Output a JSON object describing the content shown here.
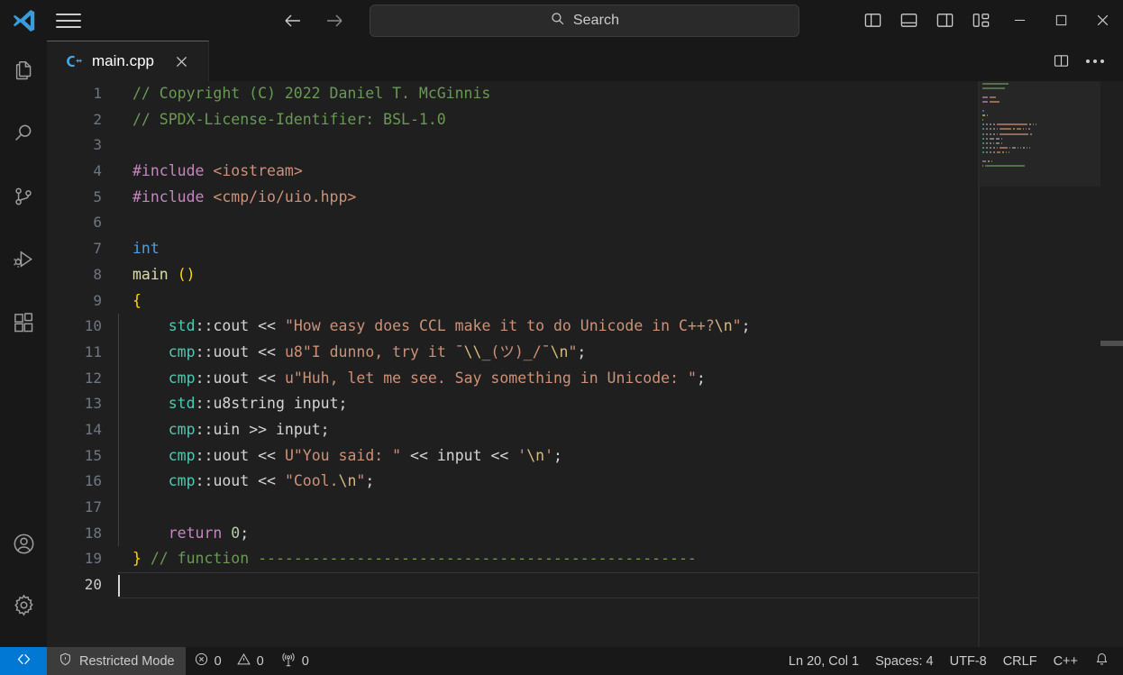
{
  "titlebar": {
    "logo_icon": "vscode-logo-icon",
    "menu_icon": "hamburger-menu-icon",
    "back_icon": "arrow-left-icon",
    "forward_icon": "arrow-right-icon",
    "search": {
      "icon": "search-icon",
      "label": "Search",
      "placeholder": "Search"
    },
    "layout_buttons": [
      {
        "name": "toggle-primary-sidebar-button",
        "icon": "layout-sidebar-left-icon"
      },
      {
        "name": "toggle-panel-button",
        "icon": "layout-panel-bottom-icon"
      },
      {
        "name": "toggle-secondary-sidebar-button",
        "icon": "layout-sidebar-right-icon"
      },
      {
        "name": "customize-layout-button",
        "icon": "layout-customize-icon"
      }
    ],
    "window_controls": [
      {
        "name": "minimize-button",
        "icon": "minimize-icon"
      },
      {
        "name": "maximize-button",
        "icon": "maximize-icon"
      },
      {
        "name": "close-button",
        "icon": "close-icon"
      }
    ]
  },
  "activitybar": {
    "top_items": [
      {
        "name": "sidebar-item-explorer",
        "icon": "files-icon",
        "label": "Explorer"
      },
      {
        "name": "sidebar-item-search",
        "icon": "search-icon",
        "label": "Search"
      },
      {
        "name": "sidebar-item-source-control",
        "icon": "source-control-branch-icon",
        "label": "Source Control"
      },
      {
        "name": "sidebar-item-run-debug",
        "icon": "run-and-debug-icon",
        "label": "Run and Debug"
      },
      {
        "name": "sidebar-item-extensions",
        "icon": "extensions-blocks-icon",
        "label": "Extensions"
      }
    ],
    "bottom_items": [
      {
        "name": "sidebar-item-account",
        "icon": "account-person-icon",
        "label": "Accounts"
      },
      {
        "name": "sidebar-item-settings",
        "icon": "gear-icon",
        "label": "Manage"
      }
    ]
  },
  "tabbar": {
    "tabs": [
      {
        "name": "tab-main-cpp",
        "label": "main.cpp",
        "icon": "cpp-file-icon",
        "active": true,
        "close_icon": "close-icon"
      }
    ],
    "actions": [
      {
        "name": "split-editor-right-button",
        "icon": "split-editor-icon"
      },
      {
        "name": "more-actions-button",
        "icon": "ellipsis-icon"
      }
    ]
  },
  "editor": {
    "language": "cpp",
    "first_line": 1,
    "lines": [
      {
        "n": 1,
        "tokens": [
          {
            "t": "// Copyright (C) 2022 Daniel T. McGinnis",
            "c": "t-com"
          }
        ]
      },
      {
        "n": 2,
        "tokens": [
          {
            "t": "// SPDX-License-Identifier: BSL-1.0",
            "c": "t-com"
          }
        ]
      },
      {
        "n": 3,
        "tokens": []
      },
      {
        "n": 4,
        "tokens": [
          {
            "t": "#include",
            "c": "t-pre"
          },
          {
            "t": " ",
            "c": "t-plain"
          },
          {
            "t": "<iostream>",
            "c": "t-hdr"
          }
        ]
      },
      {
        "n": 5,
        "tokens": [
          {
            "t": "#include",
            "c": "t-pre"
          },
          {
            "t": " ",
            "c": "t-plain"
          },
          {
            "t": "<cmp/io/uio.hpp>",
            "c": "t-hdr"
          }
        ]
      },
      {
        "n": 6,
        "tokens": []
      },
      {
        "n": 7,
        "tokens": [
          {
            "t": "int",
            "c": "t-type"
          }
        ]
      },
      {
        "n": 8,
        "tokens": [
          {
            "t": "main",
            "c": "t-fn"
          },
          {
            "t": " ",
            "c": "t-plain"
          },
          {
            "t": "()",
            "c": "t-brk"
          }
        ]
      },
      {
        "n": 9,
        "tokens": [
          {
            "t": "{",
            "c": "t-brk"
          }
        ]
      },
      {
        "n": 10,
        "tokens": [
          {
            "t": "    ",
            "c": "t-plain"
          },
          {
            "t": "std",
            "c": "t-ns"
          },
          {
            "t": "::",
            "c": "t-plain"
          },
          {
            "t": "cout",
            "c": "t-plain"
          },
          {
            "t": " ",
            "c": "t-plain"
          },
          {
            "t": "<<",
            "c": "t-op"
          },
          {
            "t": " ",
            "c": "t-plain"
          },
          {
            "t": "\"How easy does CCL make it to do Unicode in C++?",
            "c": "t-str"
          },
          {
            "t": "\\n",
            "c": "t-esc"
          },
          {
            "t": "\"",
            "c": "t-str"
          },
          {
            "t": ";",
            "c": "t-plain"
          }
        ]
      },
      {
        "n": 11,
        "tokens": [
          {
            "t": "    ",
            "c": "t-plain"
          },
          {
            "t": "cmp",
            "c": "t-ns"
          },
          {
            "t": "::",
            "c": "t-plain"
          },
          {
            "t": "uout",
            "c": "t-plain"
          },
          {
            "t": " ",
            "c": "t-plain"
          },
          {
            "t": "<<",
            "c": "t-op"
          },
          {
            "t": " ",
            "c": "t-plain"
          },
          {
            "t": "u8",
            "c": "t-str"
          },
          {
            "t": "\"I dunno, try it ¯",
            "c": "t-str"
          },
          {
            "t": "\\\\",
            "c": "t-esc"
          },
          {
            "t": "_(ツ)_/¯",
            "c": "t-str"
          },
          {
            "t": "\\n",
            "c": "t-esc"
          },
          {
            "t": "\"",
            "c": "t-str"
          },
          {
            "t": ";",
            "c": "t-plain"
          }
        ]
      },
      {
        "n": 12,
        "tokens": [
          {
            "t": "    ",
            "c": "t-plain"
          },
          {
            "t": "cmp",
            "c": "t-ns"
          },
          {
            "t": "::",
            "c": "t-plain"
          },
          {
            "t": "uout",
            "c": "t-plain"
          },
          {
            "t": " ",
            "c": "t-plain"
          },
          {
            "t": "<<",
            "c": "t-op"
          },
          {
            "t": " ",
            "c": "t-plain"
          },
          {
            "t": "u",
            "c": "t-str"
          },
          {
            "t": "\"Huh, let me see. Say something in Unicode: \"",
            "c": "t-str"
          },
          {
            "t": ";",
            "c": "t-plain"
          }
        ]
      },
      {
        "n": 13,
        "tokens": [
          {
            "t": "    ",
            "c": "t-plain"
          },
          {
            "t": "std",
            "c": "t-ns"
          },
          {
            "t": "::",
            "c": "t-plain"
          },
          {
            "t": "u8string",
            "c": "t-plain"
          },
          {
            "t": " ",
            "c": "t-plain"
          },
          {
            "t": "input",
            "c": "t-plain"
          },
          {
            "t": ";",
            "c": "t-plain"
          }
        ]
      },
      {
        "n": 14,
        "tokens": [
          {
            "t": "    ",
            "c": "t-plain"
          },
          {
            "t": "cmp",
            "c": "t-ns"
          },
          {
            "t": "::",
            "c": "t-plain"
          },
          {
            "t": "uin",
            "c": "t-plain"
          },
          {
            "t": " ",
            "c": "t-plain"
          },
          {
            "t": ">>",
            "c": "t-op"
          },
          {
            "t": " ",
            "c": "t-plain"
          },
          {
            "t": "input",
            "c": "t-plain"
          },
          {
            "t": ";",
            "c": "t-plain"
          }
        ]
      },
      {
        "n": 15,
        "tokens": [
          {
            "t": "    ",
            "c": "t-plain"
          },
          {
            "t": "cmp",
            "c": "t-ns"
          },
          {
            "t": "::",
            "c": "t-plain"
          },
          {
            "t": "uout",
            "c": "t-plain"
          },
          {
            "t": " ",
            "c": "t-plain"
          },
          {
            "t": "<<",
            "c": "t-op"
          },
          {
            "t": " ",
            "c": "t-plain"
          },
          {
            "t": "U",
            "c": "t-str"
          },
          {
            "t": "\"You said: \"",
            "c": "t-str"
          },
          {
            "t": " ",
            "c": "t-plain"
          },
          {
            "t": "<<",
            "c": "t-op"
          },
          {
            "t": " ",
            "c": "t-plain"
          },
          {
            "t": "input",
            "c": "t-plain"
          },
          {
            "t": " ",
            "c": "t-plain"
          },
          {
            "t": "<<",
            "c": "t-op"
          },
          {
            "t": " ",
            "c": "t-plain"
          },
          {
            "t": "'",
            "c": "t-str"
          },
          {
            "t": "\\n",
            "c": "t-esc"
          },
          {
            "t": "'",
            "c": "t-str"
          },
          {
            "t": ";",
            "c": "t-plain"
          }
        ]
      },
      {
        "n": 16,
        "tokens": [
          {
            "t": "    ",
            "c": "t-plain"
          },
          {
            "t": "cmp",
            "c": "t-ns"
          },
          {
            "t": "::",
            "c": "t-plain"
          },
          {
            "t": "uout",
            "c": "t-plain"
          },
          {
            "t": " ",
            "c": "t-plain"
          },
          {
            "t": "<<",
            "c": "t-op"
          },
          {
            "t": " ",
            "c": "t-plain"
          },
          {
            "t": "\"Cool.",
            "c": "t-str"
          },
          {
            "t": "\\n",
            "c": "t-esc"
          },
          {
            "t": "\"",
            "c": "t-str"
          },
          {
            "t": ";",
            "c": "t-plain"
          }
        ]
      },
      {
        "n": 17,
        "tokens": []
      },
      {
        "n": 18,
        "tokens": [
          {
            "t": "    ",
            "c": "t-plain"
          },
          {
            "t": "return",
            "c": "t-kw"
          },
          {
            "t": " ",
            "c": "t-plain"
          },
          {
            "t": "0",
            "c": "t-num"
          },
          {
            "t": ";",
            "c": "t-plain"
          }
        ]
      },
      {
        "n": 19,
        "tokens": [
          {
            "t": "}",
            "c": "t-brk"
          },
          {
            "t": " ",
            "c": "t-plain"
          },
          {
            "t": "// function -------------------------------------------------",
            "c": "t-com"
          }
        ]
      },
      {
        "n": 20,
        "tokens": [],
        "active": true,
        "cursor_col": 1
      }
    ]
  },
  "statusbar": {
    "remote": {
      "name": "remote-indicator",
      "icon": "remote-connect-icon"
    },
    "left_items": [
      {
        "name": "status-restricted-mode",
        "icon": "shield-icon",
        "label": "Restricted Mode"
      },
      {
        "name": "status-problems",
        "icon": "error-circle-icon",
        "label": "0",
        "icon2": "warning-triangle-icon",
        "label2": "0"
      },
      {
        "name": "status-ports",
        "icon": "radio-tower-icon",
        "label": "0"
      }
    ],
    "right_items": [
      {
        "name": "status-cursor-position",
        "label": "Ln 20, Col 1"
      },
      {
        "name": "status-indentation",
        "label": "Spaces: 4"
      },
      {
        "name": "status-encoding",
        "label": "UTF-8"
      },
      {
        "name": "status-eol",
        "label": "CRLF"
      },
      {
        "name": "status-language-mode",
        "label": "C++"
      },
      {
        "name": "status-notifications",
        "icon": "bell-icon",
        "label": ""
      }
    ]
  },
  "colors": {
    "accent": "#0078d4",
    "titlebar_bg": "#181818",
    "editor_bg": "#1f1f1f",
    "statusbar_bg": "#181818",
    "comment": "#6a9955",
    "string": "#ce9178",
    "keyword": "#c586c0",
    "type": "#569cd6",
    "function": "#dcdcaa",
    "namespace": "#4ec9b0",
    "bracket": "#ffd700"
  }
}
